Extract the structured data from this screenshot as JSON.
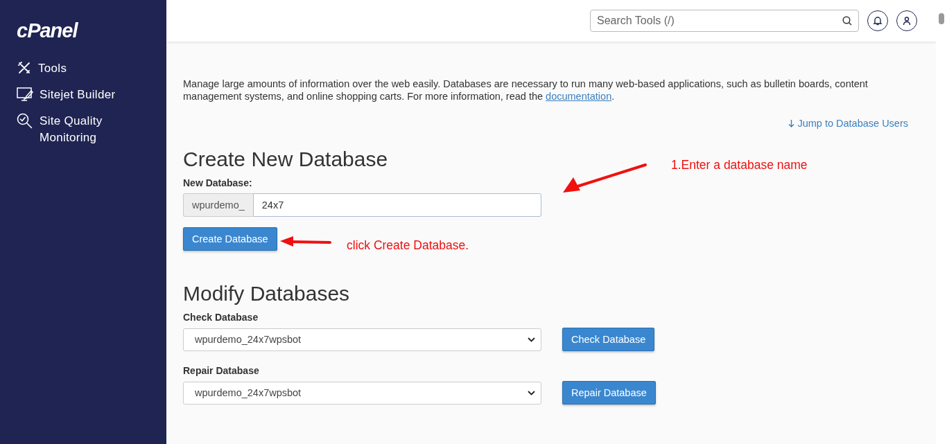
{
  "sidebar": {
    "logo": "cPanel",
    "items": [
      {
        "label": "Tools"
      },
      {
        "label": "Sitejet Builder"
      },
      {
        "label": "Site Quality Monitoring"
      }
    ]
  },
  "header": {
    "search": {
      "placeholder": "Search Tools (/)"
    }
  },
  "page": {
    "intro": {
      "text_before": "Manage large amounts of information over the web easily. Databases are necessary to run many web-based applications, such as bulletin boards, content management systems, and online shopping carts. For more information, read the ",
      "link": "documentation",
      "text_after": "."
    },
    "jump_link": "Jump to Database Users",
    "create": {
      "heading": "Create New Database",
      "label": "New Database:",
      "prefix": "wpurdemo_",
      "value": "24x7",
      "button": "Create Database"
    },
    "modify": {
      "heading": "Modify Databases",
      "rows": [
        {
          "label": "Check Database",
          "value": "wpurdemo_24x7wpsbot",
          "button": "Check Database"
        },
        {
          "label": "Repair Database",
          "value": "wpurdemo_24x7wpsbot",
          "button": "Repair Database"
        }
      ]
    }
  },
  "annotations": [
    {
      "text": "1.Enter a database name"
    },
    {
      "text": "click Create Database."
    }
  ]
}
